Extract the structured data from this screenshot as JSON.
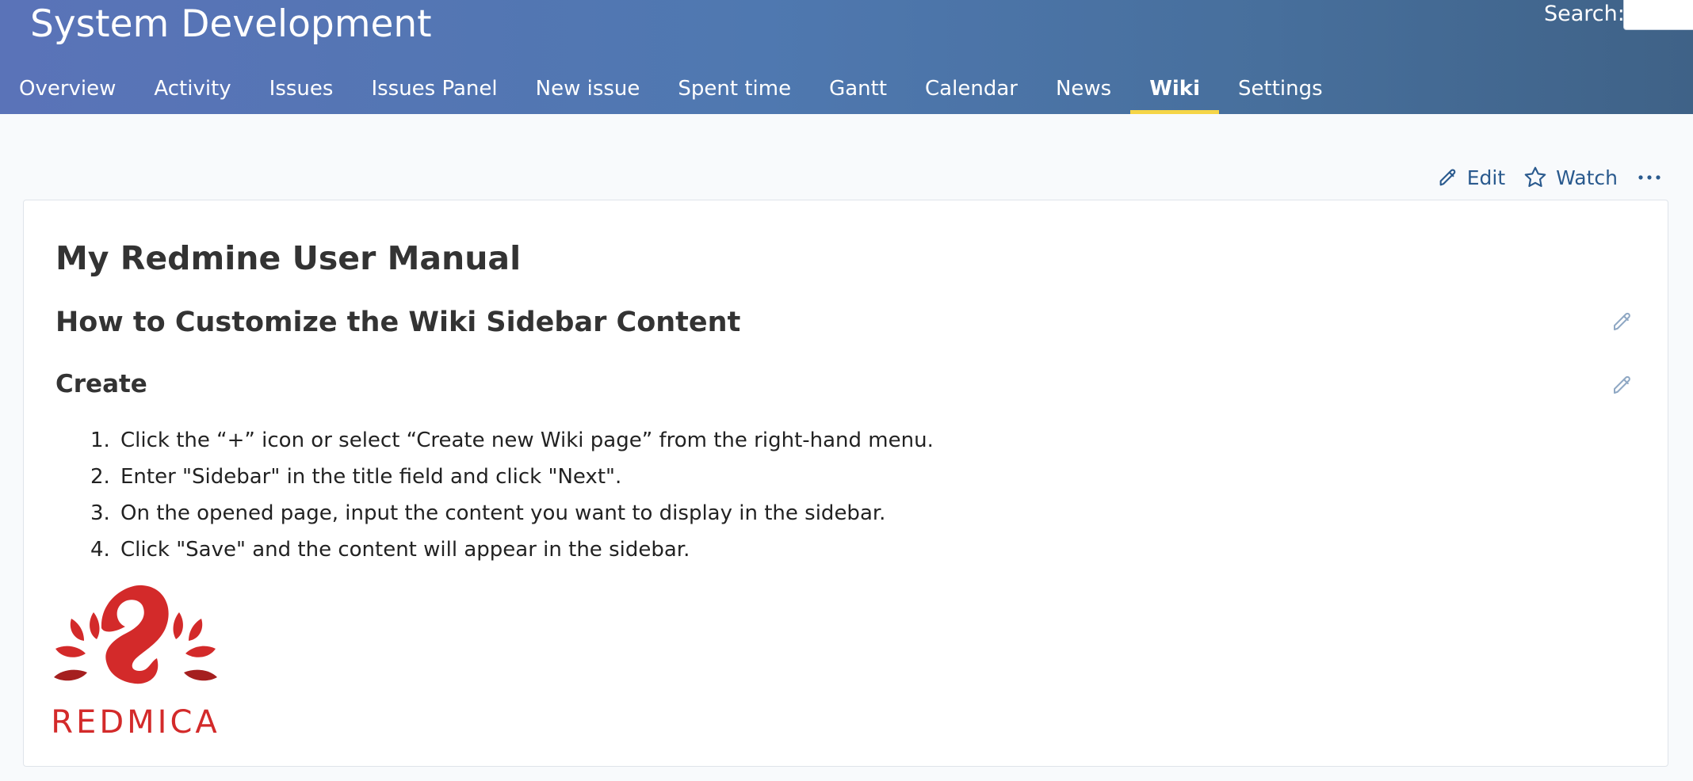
{
  "header": {
    "project_title": "System Development",
    "search_label": "Search:",
    "search_value": ""
  },
  "menu": {
    "items": [
      {
        "label": "Overview"
      },
      {
        "label": "Activity"
      },
      {
        "label": "Issues"
      },
      {
        "label": "Issues Panel"
      },
      {
        "label": "New issue"
      },
      {
        "label": "Spent time"
      },
      {
        "label": "Gantt"
      },
      {
        "label": "Calendar"
      },
      {
        "label": "News"
      },
      {
        "label": "Wiki"
      },
      {
        "label": "Settings"
      }
    ],
    "selected": "Wiki"
  },
  "contextual": {
    "edit_label": "Edit",
    "watch_label": "Watch",
    "icons": [
      "pencil-icon",
      "star-icon",
      "more-icon"
    ]
  },
  "wiki": {
    "title": "My Redmine User Manual",
    "section_heading": "How to Customize the Wiki Sidebar Content",
    "sub_heading": "Create",
    "steps": [
      {
        "num": "1.",
        "text": "Click the “+” icon or select “Create new Wiki page” from the right-hand menu."
      },
      {
        "num": "2.",
        "text": "Enter \"Sidebar\" in the title field and click \"Next\"."
      },
      {
        "num": "3.",
        "text": "On the opened page, input the content you want to display in the sidebar."
      },
      {
        "num": "4.",
        "text": "Click \"Save\" and the content will appear in the sidebar."
      }
    ],
    "logo_text": "REDMICA"
  },
  "colors": {
    "header_gradient_start": "#5a73b8",
    "header_gradient_end": "#3f6287",
    "selected_tab_underline": "#f5d547",
    "link_blue": "#2a5a8e",
    "logo_red": "#d32a2a"
  }
}
